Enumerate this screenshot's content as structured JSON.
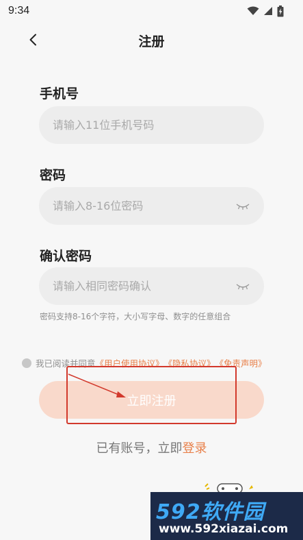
{
  "status_bar": {
    "time": "9:34"
  },
  "nav": {
    "title": "注册",
    "back_icon": "chevron-left-icon"
  },
  "form": {
    "phone": {
      "label": "手机号",
      "placeholder": "请输入11位手机号码"
    },
    "password": {
      "label": "密码",
      "placeholder": "请输入8-16位密码",
      "eye_icon": "eye-closed-icon"
    },
    "confirm": {
      "label": "确认密码",
      "placeholder": "请输入相同密码确认",
      "eye_icon": "eye-closed-icon"
    },
    "hint": "密码支持8-16个字符，大小写字母、数字的任意组合"
  },
  "agreement": {
    "prefix": "我已阅读并同意",
    "user_agreement": "《用户使用协议》",
    "privacy": "《隐私协议》",
    "disclaimer": "《免责声明》"
  },
  "register_button": "立即注册",
  "login": {
    "prompt": "已有账号，立即",
    "link": "登录"
  },
  "watermark": {
    "brand": "592软件园",
    "url": "www.592xiazai.com"
  },
  "colors": {
    "accent": "#e8804a",
    "button_bg": "#f9d9cb",
    "annotation": "#d2392c",
    "background": "#f7f7f7"
  }
}
